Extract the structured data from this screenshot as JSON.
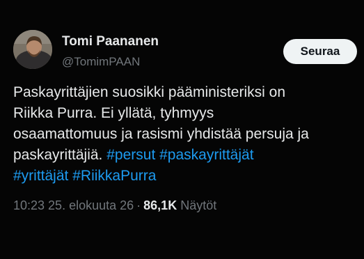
{
  "author": {
    "name": "Tomi Paananen",
    "handle": "@TomimPAAN",
    "avatar": "profile-photo"
  },
  "follow_button": {
    "label": "Seuraa"
  },
  "tweet": {
    "lines": [
      [
        {
          "text": "Paskayrittäjien suosikki pääministeriksi on",
          "hashtag": false
        }
      ],
      [
        {
          "text": "Riikka Purra. Ei yllätä, tyhmyys",
          "hashtag": false
        }
      ],
      [
        {
          "text": "osaamattomuus ja rasismi yhdistää persuja ja",
          "hashtag": false
        }
      ],
      [
        {
          "text": "paskayrittäjiä. ",
          "hashtag": false
        },
        {
          "text": "#persut",
          "hashtag": true
        },
        {
          "text": " ",
          "hashtag": false
        },
        {
          "text": "#paskayrittäjät",
          "hashtag": true
        }
      ],
      [
        {
          "text": "#yrittäjät",
          "hashtag": true
        },
        {
          "text": " ",
          "hashtag": false
        },
        {
          "text": "#RiikkaPurra",
          "hashtag": true
        }
      ]
    ]
  },
  "meta": {
    "timestamp": "10:23 25. elokuuta 26",
    "separator": "·",
    "views_count": "86,1K",
    "views_label": "Näytöt"
  },
  "colors": {
    "background": "#050505",
    "text": "#e7e9ea",
    "secondary": "#71767b",
    "hashtag": "#1d9bf0",
    "button_bg": "#eff3f4"
  }
}
